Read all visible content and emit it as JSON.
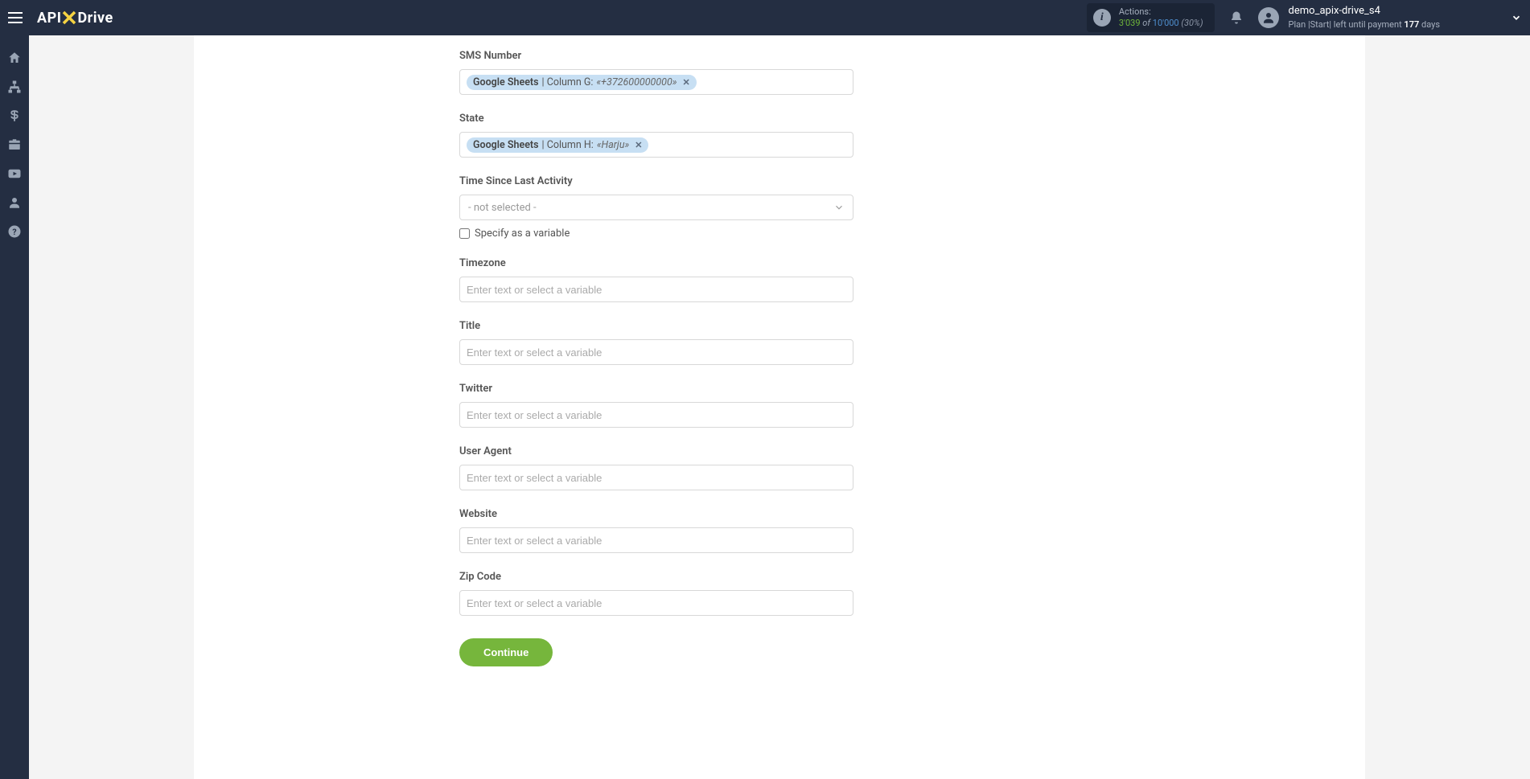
{
  "logo": {
    "api": "API",
    "drive": "Drive"
  },
  "header": {
    "actions_label": "Actions:",
    "actions_current": "3'039",
    "actions_of": "of",
    "actions_max": "10'000",
    "actions_pct": "(30%)",
    "username": "demo_apix-drive_s4",
    "plan_prefix": "Plan ",
    "plan_name": "|Start|",
    "plan_suffix": " left until payment ",
    "plan_days": "177",
    "plan_days_word": " days"
  },
  "fields": {
    "sms_number": {
      "label": "SMS Number",
      "pill_src": "Google Sheets",
      "pill_sep": " | ",
      "pill_col": "Column G: ",
      "pill_val": "«+372600000000»"
    },
    "state": {
      "label": "State",
      "pill_src": "Google Sheets",
      "pill_sep": " | ",
      "pill_col": "Column H: ",
      "pill_val": "«Harju»"
    },
    "time_since": {
      "label": "Time Since Last Activity",
      "selected_text": "- not selected -",
      "specify_label": "Specify as a variable"
    },
    "timezone": {
      "label": "Timezone",
      "placeholder": "Enter text or select a variable"
    },
    "title": {
      "label": "Title",
      "placeholder": "Enter text or select a variable"
    },
    "twitter": {
      "label": "Twitter",
      "placeholder": "Enter text or select a variable"
    },
    "user_agent": {
      "label": "User Agent",
      "placeholder": "Enter text or select a variable"
    },
    "website": {
      "label": "Website",
      "placeholder": "Enter text or select a variable"
    },
    "zip_code": {
      "label": "Zip Code",
      "placeholder": "Enter text or select a variable"
    }
  },
  "buttons": {
    "continue": "Continue"
  }
}
